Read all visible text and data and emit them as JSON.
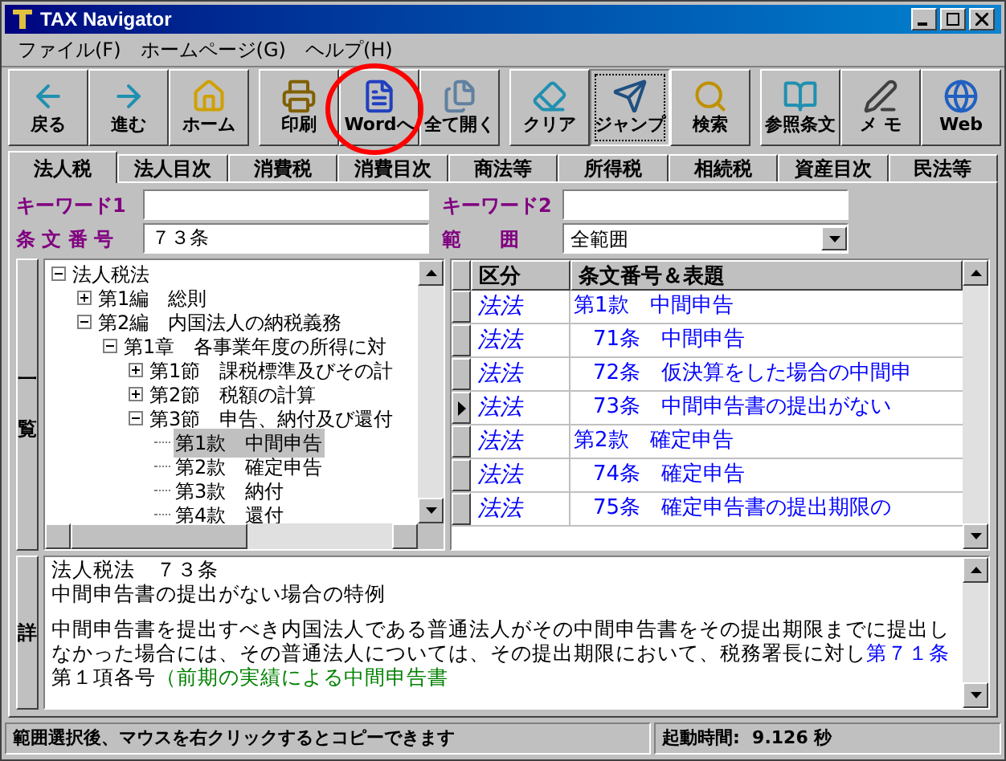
{
  "window": {
    "title": "TAX Navigator"
  },
  "menu": [
    "ファイル(F)",
    "ホームページ(G)",
    "ヘルプ(H)"
  ],
  "toolbar": [
    {
      "label": "戻る",
      "pressed": false
    },
    {
      "label": "進む",
      "pressed": false
    },
    {
      "label": "ホーム",
      "pressed": false
    },
    {
      "label": "印刷",
      "pressed": false
    },
    {
      "label": "Wordへ",
      "pressed": false
    },
    {
      "label": "全て開く",
      "pressed": false
    },
    {
      "label": "クリア",
      "pressed": false
    },
    {
      "label": "ジャンプ",
      "pressed": true
    },
    {
      "label": "検索",
      "pressed": false
    },
    {
      "label": "参照条文",
      "pressed": false
    },
    {
      "label": "メ モ",
      "pressed": false
    },
    {
      "label": "Web",
      "pressed": false
    }
  ],
  "tabs": [
    {
      "label": "法人税",
      "selected": true
    },
    {
      "label": "法人目次",
      "selected": false
    },
    {
      "label": "消費税",
      "selected": false
    },
    {
      "label": "消費目次",
      "selected": false
    },
    {
      "label": "商法等",
      "selected": false
    },
    {
      "label": "所得税",
      "selected": false
    },
    {
      "label": "相続税",
      "selected": false
    },
    {
      "label": "資産目次",
      "selected": false
    },
    {
      "label": "民法等",
      "selected": false
    }
  ],
  "search": {
    "keyword1": {
      "label": "キーワード1"
    },
    "keyword2": {
      "label": "キーワード2"
    },
    "article_number": {
      "label": "条 文 番 号",
      "value": "７３条"
    },
    "scope": {
      "label": "範　　囲",
      "value": "全範囲"
    }
  },
  "list_label": "一覧",
  "tree": [
    {
      "label": "法人税法",
      "expanded": true,
      "selected": false,
      "children": [
        {
          "label": "第1編　総則",
          "expanded": false,
          "selected": false
        },
        {
          "label": "第2編　内国法人の納税義務",
          "expanded": true,
          "selected": false,
          "children": [
            {
              "label": "第1章　各事業年度の所得に対",
              "expanded": true,
              "selected": false,
              "children": [
                {
                  "label": "第1節　課税標準及びその計",
                  "expanded": false,
                  "selected": false
                },
                {
                  "label": "第2節　税額の計算",
                  "expanded": false,
                  "selected": false
                },
                {
                  "label": "第3節　申告、納付及び還付",
                  "expanded": true,
                  "selected": false,
                  "children": [
                    {
                      "label": "第1款　中間申告",
                      "selected": true
                    },
                    {
                      "label": "第2款　確定申告",
                      "selected": false
                    },
                    {
                      "label": "第3款　納付",
                      "selected": false
                    },
                    {
                      "label": "第4款　還付",
                      "selected": false
                    }
                  ]
                }
              ]
            }
          ]
        }
      ]
    }
  ],
  "table": {
    "columns": [
      "区分",
      "条文番号＆表題"
    ],
    "rows": [
      {
        "kind": "section",
        "category": "法法",
        "title": "第1款　中間申告",
        "selected": false
      },
      {
        "kind": "article",
        "category": "法法",
        "title": "71条　中間申告",
        "selected": false
      },
      {
        "kind": "article",
        "category": "法法",
        "title": "72条　仮決算をした場合の中間申",
        "selected": false
      },
      {
        "kind": "article",
        "category": "法法",
        "title": "73条　中間申告書の提出がない",
        "selected": true
      },
      {
        "kind": "section",
        "category": "法法",
        "title": "第2款　確定申告",
        "selected": false
      },
      {
        "kind": "article",
        "category": "法法",
        "title": "74条　確定申告",
        "selected": false
      },
      {
        "kind": "article",
        "category": "法法",
        "title": "75条　確定申告書の提出期限の",
        "selected": false
      }
    ]
  },
  "detail": {
    "label": "詳",
    "heading": [
      "法人税法　７３条",
      "中間申告書の提出がない場合の特例"
    ],
    "body": "中間申告書を提出すべき内国法人である普通法人がその中間申告書をその提出期限までに提出しなかった場合には、その普通法人については、その提出期限において、税務署長に対し",
    "link": "第７１条",
    "body2": "第１項各号",
    "note": "（前期の実績による中間申告書"
  },
  "status_bar": {
    "message": "範囲選択後、マウスを右クリックするとコピーできます",
    "startup_time": "起動時間:  9.126 秒"
  }
}
